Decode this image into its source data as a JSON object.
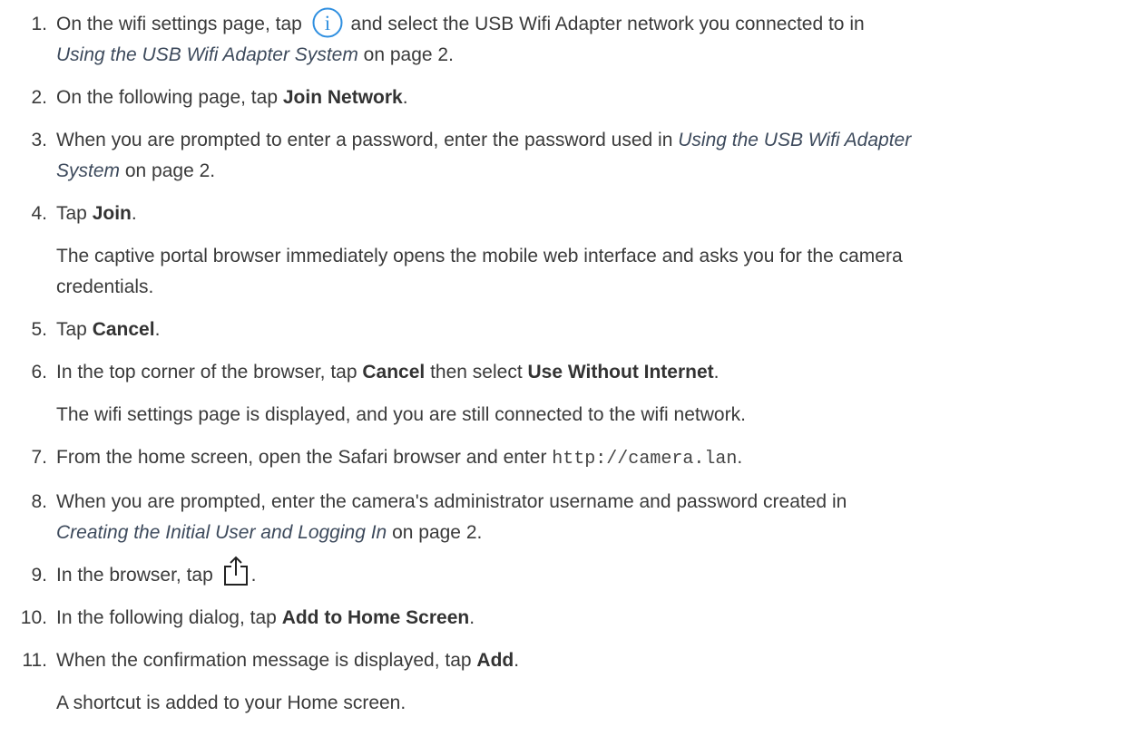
{
  "steps": [
    {
      "num": "1.",
      "t1": "On the wifi settings page, tap",
      "icon": "info-icon",
      "t2": "and select the USB Wifi Adapter network you connected to in",
      "xref": "Using the USB Wifi Adapter System",
      "t3": "on page 2."
    },
    {
      "num": "2.",
      "t1": "On the following page, tap",
      "b1": "Join Network",
      "t2": "."
    },
    {
      "num": "3.",
      "t1": "When you are prompted to enter a password, enter the password used in",
      "xref1": "Using the USB Wifi Adapter",
      "xref2": "System",
      "t2": "on page 2."
    },
    {
      "num": "4.",
      "t1": "Tap",
      "b1": "Join",
      "t2": ".",
      "follow1": "The captive portal browser immediately opens the mobile web interface and asks you for the camera",
      "follow2": "credentials."
    },
    {
      "num": "5.",
      "t1": "Tap",
      "b1": "Cancel",
      "t2": "."
    },
    {
      "num": "6.",
      "t1": "In the top corner of the browser, tap",
      "b1": "Cancel",
      "t2": "then select",
      "b2": "Use Without Internet",
      "t3": ".",
      "follow": "The wifi settings page is displayed, and you are still connected to the wifi network."
    },
    {
      "num": "7.",
      "t1": "From the home screen, open the Safari browser and enter",
      "code": "http://camera.lan",
      "t2": "."
    },
    {
      "num": "8.",
      "t1": "When you are prompted, enter the camera's administrator username and password created in",
      "xref": "Creating the Initial User and Logging In",
      "t2": "on page 2."
    },
    {
      "num": "9.",
      "t1": "In the browser, tap",
      "icon": "share-icon",
      "t2": "."
    },
    {
      "num": "10.",
      "t1": "In the following dialog, tap",
      "b1": "Add to Home Screen",
      "t2": "."
    },
    {
      "num": "11.",
      "t1": "When the confirmation message is displayed, tap",
      "b1": "Add",
      "t2": ".",
      "follow": "A shortcut is added to your Home screen."
    }
  ],
  "colors": {
    "text": "#3a3a3a",
    "xref": "#3d4a5c",
    "icon": "#2f8fe0"
  }
}
